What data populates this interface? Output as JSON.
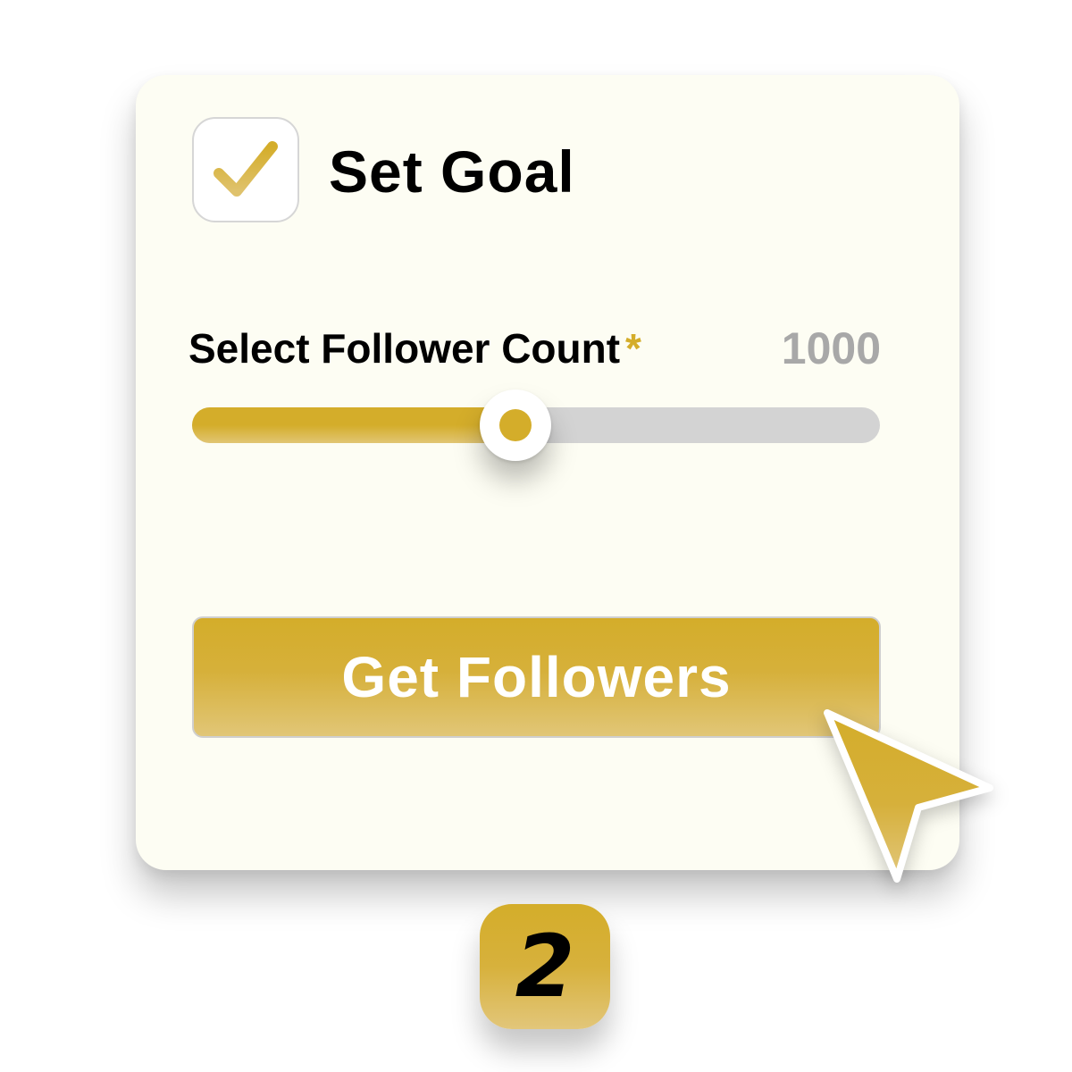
{
  "goal": {
    "checked": true,
    "label": "Set Goal"
  },
  "follower_count": {
    "label": "Select Follower Count",
    "required_marker": "*",
    "value": "1000",
    "slider_fraction": 0.47
  },
  "action": {
    "label": "Get Followers"
  },
  "step": {
    "number": "2"
  },
  "icons": {
    "checkbox": "checkmark-icon",
    "pointer": "mouse-pointer-icon"
  },
  "colors": {
    "accent": "#d4ad2a",
    "card_background": "#fdfdf3",
    "track": "#d3d3d3",
    "muted_value": "#a8a8a8"
  }
}
